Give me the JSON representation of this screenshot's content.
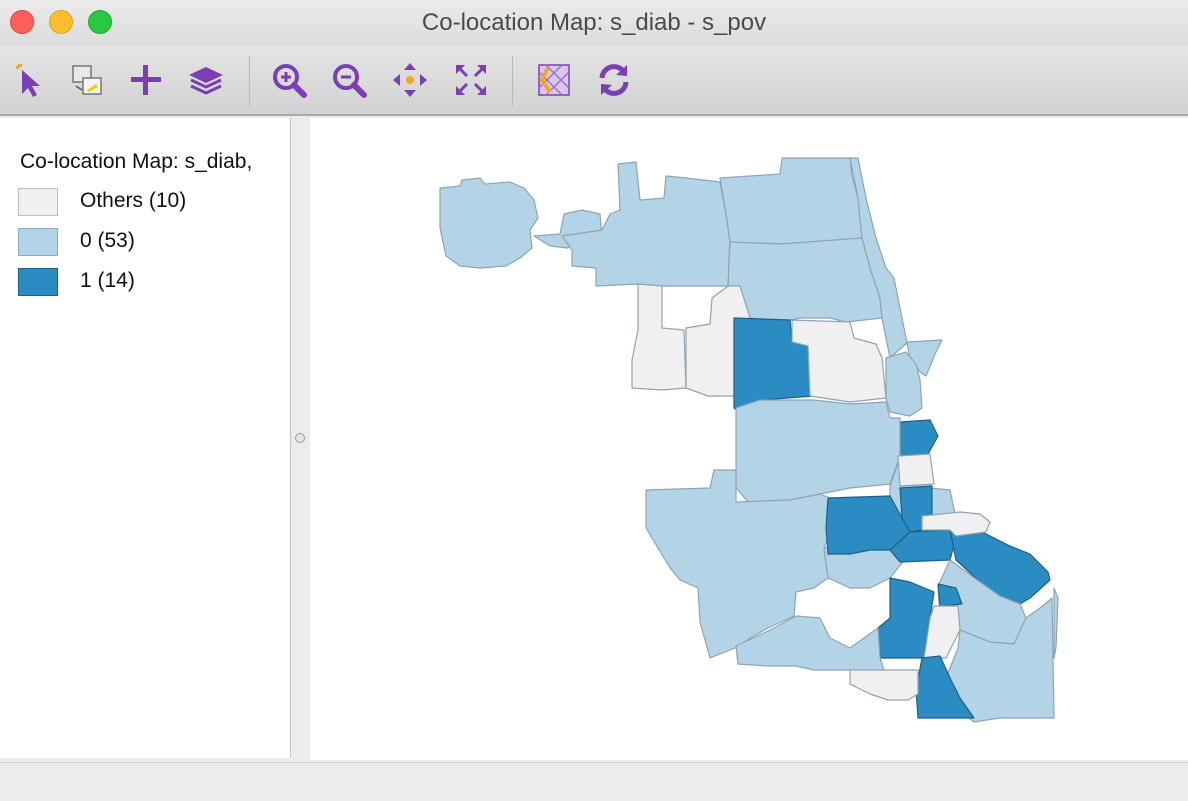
{
  "window": {
    "title": "Co-location Map: s_diab - s_pov"
  },
  "toolbar": {
    "tools": [
      {
        "name": "select-tool",
        "icon": "select-arrow-icon"
      },
      {
        "name": "selection-shape-tool",
        "icon": "selection-shape-icon"
      },
      {
        "name": "add-tool",
        "icon": "plus-icon"
      },
      {
        "name": "layers-tool",
        "icon": "layers-icon"
      },
      {
        "name": "zoom-in-tool",
        "icon": "zoom-in-icon"
      },
      {
        "name": "zoom-out-tool",
        "icon": "zoom-out-icon"
      },
      {
        "name": "pan-tool",
        "icon": "pan-icon"
      },
      {
        "name": "fit-extent-tool",
        "icon": "fit-extent-icon"
      },
      {
        "name": "basemap-tool",
        "icon": "basemap-icon"
      },
      {
        "name": "refresh-tool",
        "icon": "refresh-icon"
      }
    ],
    "icon_color": "#7b3fb5",
    "accent_color": "#f5a623"
  },
  "legend": {
    "title": "Co-location Map: s_diab,",
    "items": [
      {
        "label": "Others (10)",
        "color": "#f0f0f0",
        "border": "#bdbdbd"
      },
      {
        "label": "0 (53)",
        "color": "#b3d4e6",
        "border": "#8fa9bc"
      },
      {
        "label": "1 (14)",
        "color": "#2b8cc4",
        "border": "#1e5f87"
      }
    ]
  },
  "map": {
    "category_colors": {
      "others": "#f0f0f0",
      "zero": "#b3d4e6",
      "one": "#2b8cc4"
    },
    "boundary_color": "#8fa3b3"
  }
}
